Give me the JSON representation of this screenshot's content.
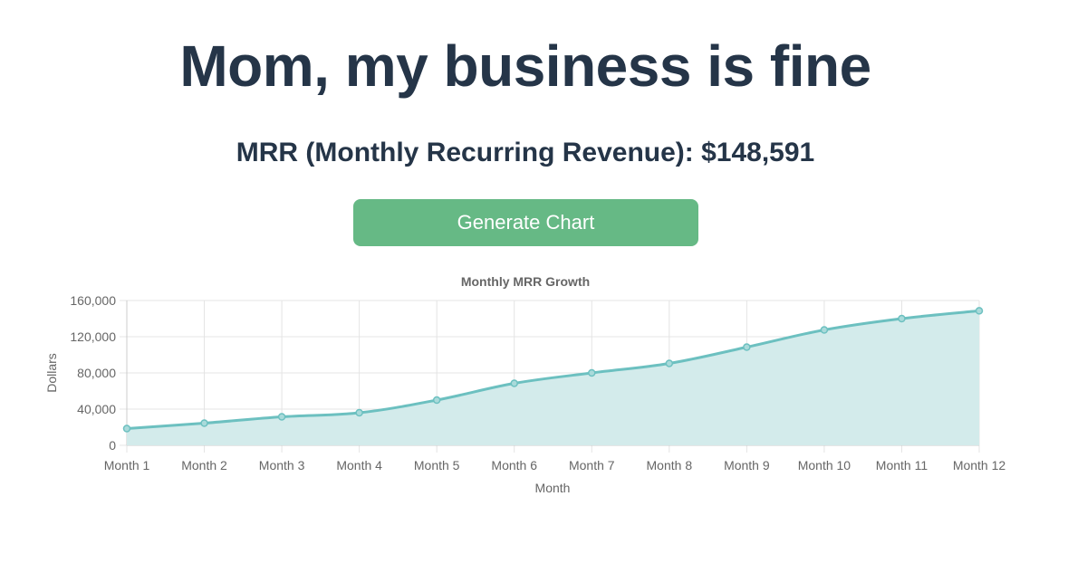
{
  "page": {
    "headline": "Mom, my business is fine",
    "mrr_label": "MRR (Monthly Recurring Revenue): $148,591",
    "generate_button": "Generate Chart"
  },
  "colors": {
    "heading": "#253548",
    "button": "#66b985",
    "line": "#6cc0c0",
    "fill": "#d3ebeb",
    "grid": "#e4e4e4"
  },
  "chart_data": {
    "type": "area",
    "title": "Monthly MRR Growth",
    "xlabel": "Month",
    "ylabel": "Dollars",
    "ylim": [
      0,
      160000
    ],
    "yticks": [
      0,
      40000,
      80000,
      120000,
      160000
    ],
    "ytick_labels": [
      "0",
      "40,000",
      "80,000",
      "120,000",
      "160,000"
    ],
    "grid": true,
    "categories": [
      "Month 1",
      "Month 2",
      "Month 3",
      "Month 4",
      "Month 5",
      "Month 6",
      "Month 7",
      "Month 8",
      "Month 9",
      "Month 10",
      "Month 11",
      "Month 12"
    ],
    "series": [
      {
        "values": [
          18500,
          24500,
          31500,
          36000,
          50000,
          68500,
          80000,
          90500,
          108500,
          127500,
          140000,
          148591
        ]
      }
    ]
  }
}
